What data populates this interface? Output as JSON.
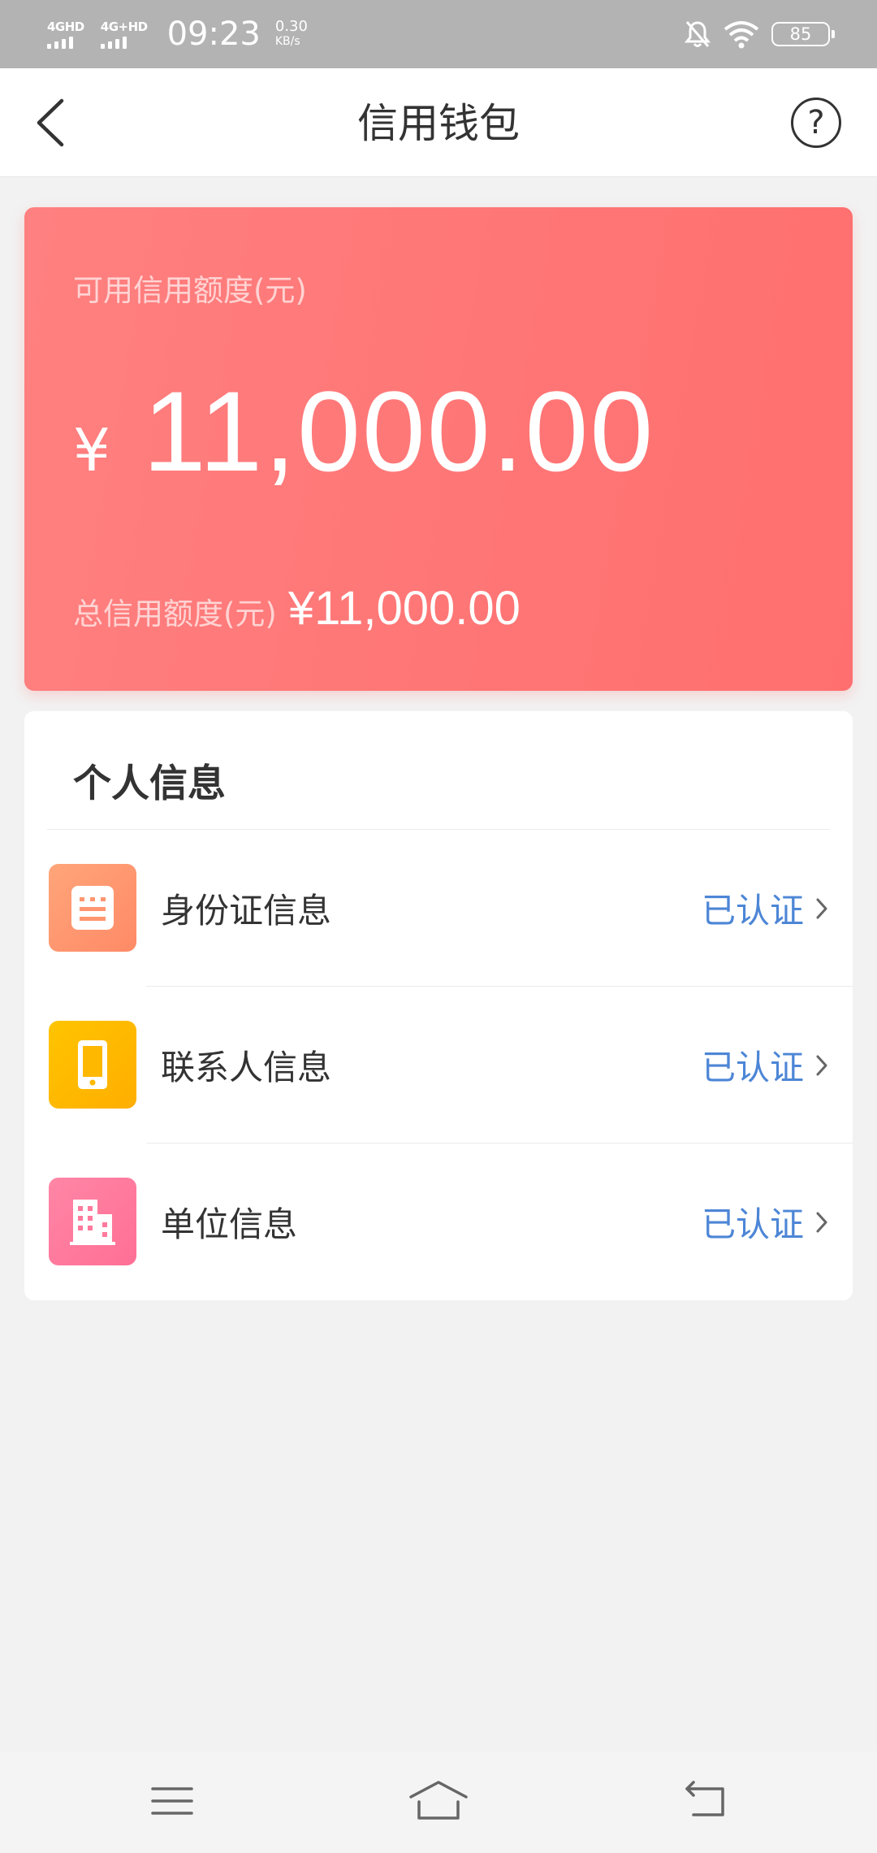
{
  "status_bar": {
    "network1": "4GHD",
    "network2": "4G+HD",
    "time": "09:23",
    "speed_value": "0.30",
    "speed_unit": "KB/s",
    "battery": "85",
    "icons": [
      "signal-icon",
      "signal-icon",
      "mute-icon",
      "wifi-icon",
      "battery-icon"
    ]
  },
  "header": {
    "title": "信用钱包",
    "back_icon": "back-arrow-icon",
    "help_symbol": "?"
  },
  "credit_card": {
    "available_label": "可用信用额度(元)",
    "currency_symbol": "¥",
    "available_amount": "11,000.00",
    "total_label": "总信用额度(元)",
    "total_amount": "¥11,000.00",
    "colors": {
      "gradient_start": "#ff8080",
      "gradient_end": "#ff6f6f"
    }
  },
  "personal_info": {
    "title": "个人信息",
    "items": [
      {
        "label": "身份证信息",
        "status": "已认证",
        "icon": "id-card-icon",
        "color_from": "#ffa57a",
        "color_to": "#ff8a66"
      },
      {
        "label": "联系人信息",
        "status": "已认证",
        "icon": "phone-icon",
        "color_from": "#ffc400",
        "color_to": "#ffae00"
      },
      {
        "label": "单位信息",
        "status": "已认证",
        "icon": "building-icon",
        "color_from": "#ff86a6",
        "color_to": "#ff6f95"
      }
    ],
    "status_color": "#4d86d6"
  },
  "nav_bar": {
    "icons": [
      "menu-icon",
      "home-icon",
      "back-icon"
    ]
  }
}
